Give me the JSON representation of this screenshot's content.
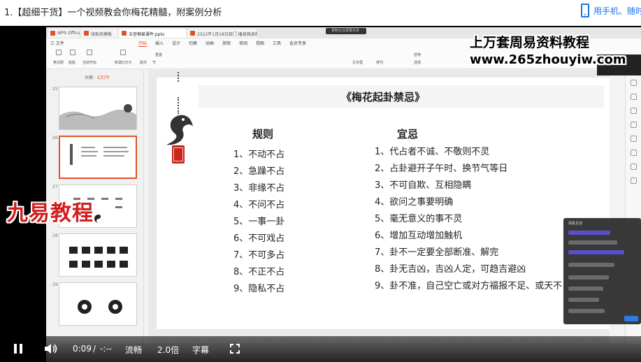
{
  "page": {
    "title": "1.【超细干货】一个视频教会你梅花精髓，附案例分析",
    "mobile_link": "用手机、随时"
  },
  "wps": {
    "tabs": [
      "WPS Office",
      "找稻壳模板",
      "五宫梅易课件.pptx",
      "2022年1月18日部门 播易微调视频 ..."
    ],
    "active_tab": 2,
    "rec_badge": "录制正在屏幕共享",
    "menu": [
      "三 文件",
      "开始",
      "插入",
      "设计",
      "切换",
      "动画",
      "放映",
      "审阅",
      "视图",
      "工具",
      "会员专享"
    ],
    "active_menu": 1,
    "ribbon": [
      "格式刷",
      "粘贴",
      "当前开始",
      "新建幻灯片",
      "版式",
      "节",
      "重置",
      "文本框",
      "排列",
      "替换",
      "选择"
    ],
    "thumb_tabs": [
      "大纲",
      "幻灯片"
    ],
    "slide_numbers": [
      "25",
      "26",
      "27",
      "28",
      "29"
    ]
  },
  "slide": {
    "title": "《梅花起卦禁忌》",
    "rules_header": "规则",
    "taboos_header": "宜忌",
    "rules": [
      "1、不动不占",
      "2、急躁不占",
      "3、非缘不占",
      "4、不问不占",
      "5、一事一卦",
      "6、不可戏占",
      "7、不可多占",
      "8、不正不占",
      "9、隐私不占"
    ],
    "taboos": [
      "1、代占者不诚、不敬则不灵",
      "2、占卦避开子午时、换节气等日",
      "3、不可自欺、互相隐瞒",
      "4、欲问之事要明确",
      "5、毫无意义的事不灵",
      "6、增加互动增加触机",
      "7、卦不一定要全部断准、解完",
      "8、卦无吉凶，吉凶人定，可趋吉避凶",
      "9、卦不准，自己空亡或对方福报不足、或天不"
    ]
  },
  "watermarks": {
    "line1": "上万套周易资料教程",
    "line2": "www.265zhouyiw.com",
    "brand": "九易教程"
  },
  "chat": {
    "title": "观看互动"
  },
  "player": {
    "time_current": "0:09",
    "time_sep": "/",
    "time_total": "-:--",
    "quality": "流畅",
    "speed": "2.0倍",
    "subtitle": "字幕"
  }
}
